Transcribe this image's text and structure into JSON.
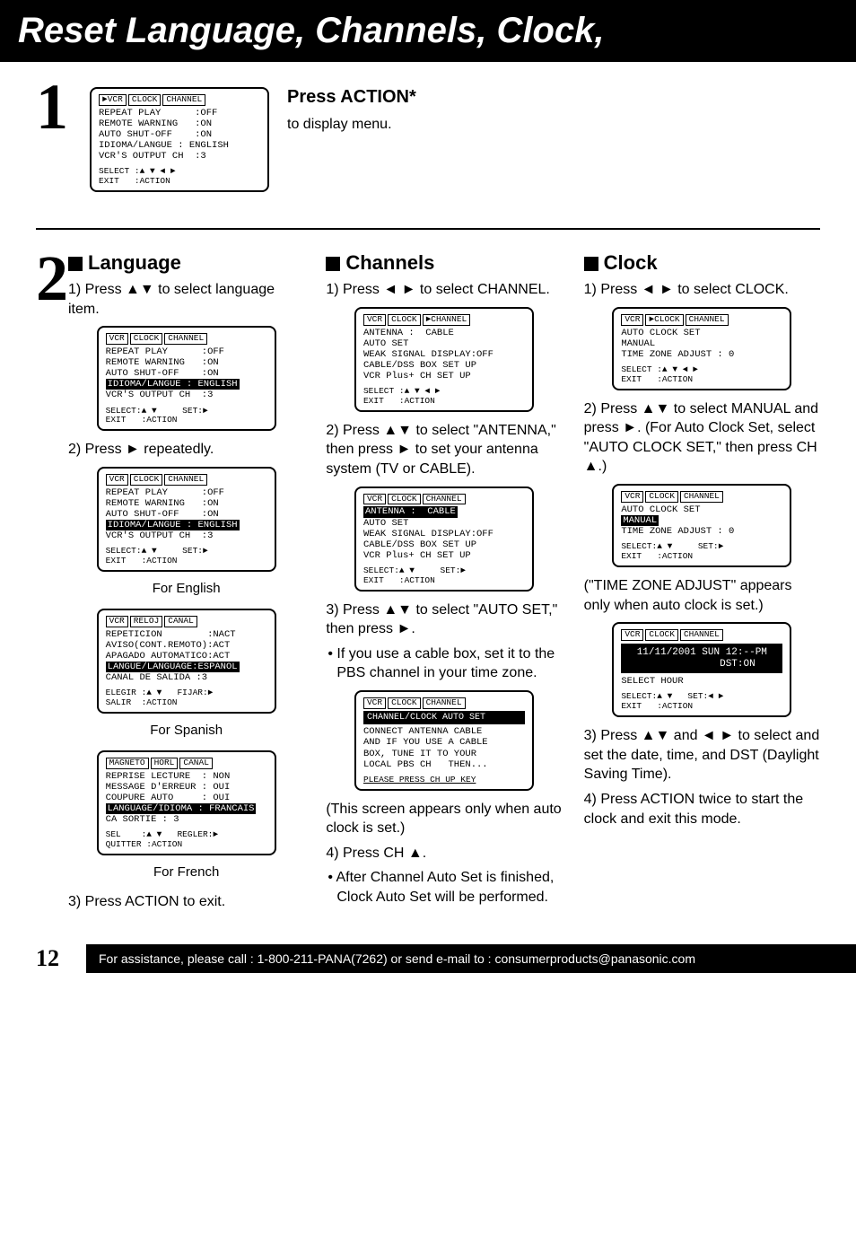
{
  "title": "Reset Language, Channels, Clock,",
  "step1": {
    "heading": "Press ACTION*",
    "sub": "to display menu.",
    "screen": {
      "tabs": [
        "►VCR",
        "CLOCK",
        "CHANNEL"
      ],
      "rows": [
        "REPEAT PLAY      :OFF",
        "REMOTE WARNING   :ON",
        "AUTO SHUT-OFF    :ON",
        "IDIOMA/LANGUE : ENGLISH",
        "VCR'S OUTPUT CH  :3"
      ],
      "footer": "SELECT :▲ ▼ ◄ ►\nEXIT   :ACTION"
    }
  },
  "language": {
    "title": "Language",
    "i1": "1) Press ▲▼ to select language item.",
    "i2": "2) Press ► repeatedly.",
    "capEn": "For English",
    "capEs": "For Spanish",
    "capFr": "For French",
    "i3": "3) Press ACTION to exit.",
    "screenA": {
      "tabs": [
        "VCR",
        "CLOCK",
        "CHANNEL"
      ],
      "rows": [
        "REPEAT PLAY      :OFF",
        "REMOTE WARNING   :ON",
        "AUTO SHUT-OFF    :ON"
      ],
      "hl": "IDIOMA/LANGUE : ENGLISH",
      "rows2": [
        "VCR'S OUTPUT CH  :3"
      ],
      "footer": "SELECT:▲ ▼     SET:►\nEXIT   :ACTION"
    },
    "screenEn": {
      "tabs": [
        "VCR",
        "CLOCK",
        "CHANNEL"
      ],
      "rows": [
        "REPEAT PLAY      :OFF",
        "REMOTE WARNING   :ON",
        "AUTO SHUT-OFF    :ON"
      ],
      "hl": "IDIOMA/LANGUE : ENGLISH",
      "rows2": [
        "VCR'S OUTPUT CH  :3"
      ],
      "footer": "SELECT:▲ ▼     SET:►\nEXIT   :ACTION"
    },
    "screenEs": {
      "tabs": [
        "VCR",
        "RELOJ",
        "CANAL"
      ],
      "rows": [
        "REPETICION        :NACT",
        "AVISO(CONT.REMOTO):ACT",
        "APAGADO AUTOMATICO:ACT"
      ],
      "hl": "LANGUE/LANGUAGE:ESPANOL",
      "rows2": [
        "CANAL DE SALIDA :3"
      ],
      "footer": "ELEGIR :▲ ▼   FIJAR:►\nSALIR  :ACTION"
    },
    "screenFr": {
      "tabs": [
        "MAGNETO",
        "HORL",
        "CANAL"
      ],
      "rows": [
        "REPRISE LECTURE  : NON",
        "MESSAGE D'ERREUR : OUI",
        "COUPURE AUTO     : OUI"
      ],
      "hl": "LANGUAGE/IDIOMA : FRANCAIS",
      "rows2": [
        "CA SORTIE : 3"
      ],
      "footer": "SEL    :▲ ▼   REGLER:►\nQUITTER :ACTION"
    }
  },
  "channels": {
    "title": "Channels",
    "i1": "1) Press ◄ ► to select CHANNEL.",
    "i2": "2) Press ▲▼ to select \"ANTENNA,\" then press ► to set your antenna system (TV or CABLE).",
    "i3": "3) Press ▲▼ to select \"AUTO SET,\" then press ►.",
    "b3": "• If you use a cable box, set it to the PBS channel in your time zone.",
    "note": "(This screen appears only when auto clock is set.)",
    "i4": "4) Press CH ▲.",
    "b4": "• After Channel Auto Set is finished, Clock Auto Set will be performed.",
    "screenA": {
      "tabs": [
        "VCR",
        "CLOCK",
        "►CHANNEL"
      ],
      "rows": [
        "ANTENNA :  CABLE",
        "AUTO SET",
        "WEAK SIGNAL DISPLAY:OFF",
        "CABLE/DSS BOX SET UP",
        "VCR Plus+ CH SET UP"
      ],
      "footer": "SELECT :▲ ▼ ◄ ►\nEXIT   :ACTION"
    },
    "screenB": {
      "tabs": [
        "VCR",
        "CLOCK",
        "CHANNEL"
      ],
      "hl": "ANTENNA :  CABLE",
      "rows": [
        "AUTO SET",
        "WEAK SIGNAL DISPLAY:OFF",
        "CABLE/DSS BOX SET UP",
        "VCR Plus+ CH SET UP"
      ],
      "footer": "SELECT:▲ ▼     SET:►\nEXIT   :ACTION"
    },
    "screenC": {
      "tabs": [
        "VCR",
        "CLOCK",
        "CHANNEL"
      ],
      "big": "CHANNEL/CLOCK AUTO SET",
      "rows": [
        "CONNECT ANTENNA CABLE",
        "AND IF YOU USE A CABLE",
        "BOX, TUNE IT TO YOUR",
        "LOCAL PBS CH   THEN..."
      ],
      "footer": "PLEASE PRESS CH UP KEY"
    }
  },
  "clock": {
    "title": "Clock",
    "i1": "1) Press ◄ ► to select CLOCK.",
    "i2a": "2) Press ▲▼ to select MANUAL and press ►. (For Auto Clock Set, select \"AUTO CLOCK SET,\" then press CH ▲.)",
    "note": "(\"TIME ZONE ADJUST\" appears only when auto clock is set.)",
    "i3": "3) Press ▲▼ and ◄ ► to select and set the date, time, and DST (Daylight Saving Time).",
    "i4": "4) Press ACTION twice to start the clock and exit this mode.",
    "screenA": {
      "tabs": [
        "VCR",
        "►CLOCK",
        "CHANNEL"
      ],
      "rows": [
        "AUTO CLOCK SET",
        "MANUAL",
        "TIME ZONE ADJUST : 0"
      ],
      "footer": "SELECT :▲ ▼ ◄ ►\nEXIT   :ACTION"
    },
    "screenB": {
      "tabs": [
        "VCR",
        "CLOCK",
        "CHANNEL"
      ],
      "rows": [
        "AUTO CLOCK SET"
      ],
      "hl": "MANUAL",
      "rows2": [
        "TIME ZONE ADJUST : 0"
      ],
      "footer": "SELECT:▲ ▼     SET:►\nEXIT   :ACTION"
    },
    "screenC": {
      "tabs": [
        "VCR",
        "CLOCK",
        "CHANNEL"
      ],
      "datetime": "11/11/2001 SUN 12:--PM\n            DST:ON",
      "rows": [
        "SELECT HOUR"
      ],
      "footer": "SELECT:▲ ▼   SET:◄ ►\nEXIT   :ACTION"
    }
  },
  "pagenum": "12",
  "assist": "For assistance, please call : 1-800-211-PANA(7262) or send e-mail to : consumerproducts@panasonic.com"
}
